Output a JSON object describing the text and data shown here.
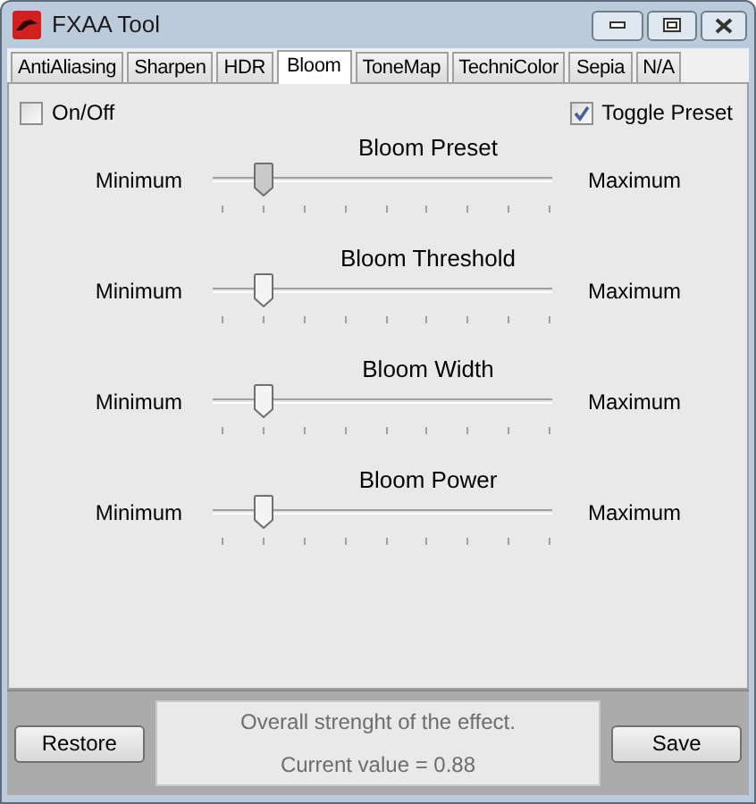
{
  "window": {
    "title": "FXAA Tool"
  },
  "tabs": [
    {
      "label": "AntiAliasing",
      "selected": false
    },
    {
      "label": "Sharpen",
      "selected": false
    },
    {
      "label": "HDR",
      "selected": false
    },
    {
      "label": "Bloom",
      "selected": true
    },
    {
      "label": "ToneMap",
      "selected": false
    },
    {
      "label": "TechniColor",
      "selected": false
    },
    {
      "label": "Sepia",
      "selected": false
    },
    {
      "label": "N/A",
      "selected": false
    }
  ],
  "on_off": {
    "label": "On/Off",
    "checked": false
  },
  "toggle_preset": {
    "label": "Toggle Preset",
    "checked": true
  },
  "sliders": [
    {
      "title": "Bloom Preset",
      "min_label": "Minimum",
      "max_label": "Maximum",
      "level": 0.125,
      "focused": true
    },
    {
      "title": "Bloom Threshold",
      "min_label": "Minimum",
      "max_label": "Maximum",
      "level": 0.125,
      "focused": false
    },
    {
      "title": "Bloom Width",
      "min_label": "Minimum",
      "max_label": "Maximum",
      "level": 0.125,
      "focused": false
    },
    {
      "title": "Bloom Power",
      "min_label": "Minimum",
      "max_label": "Maximum",
      "level": 0.125,
      "focused": false
    }
  ],
  "info": {
    "description": "Overall strenght of the effect.",
    "current_value": "Current value = 0.88"
  },
  "buttons": {
    "restore": "Restore",
    "save": "Save"
  }
}
